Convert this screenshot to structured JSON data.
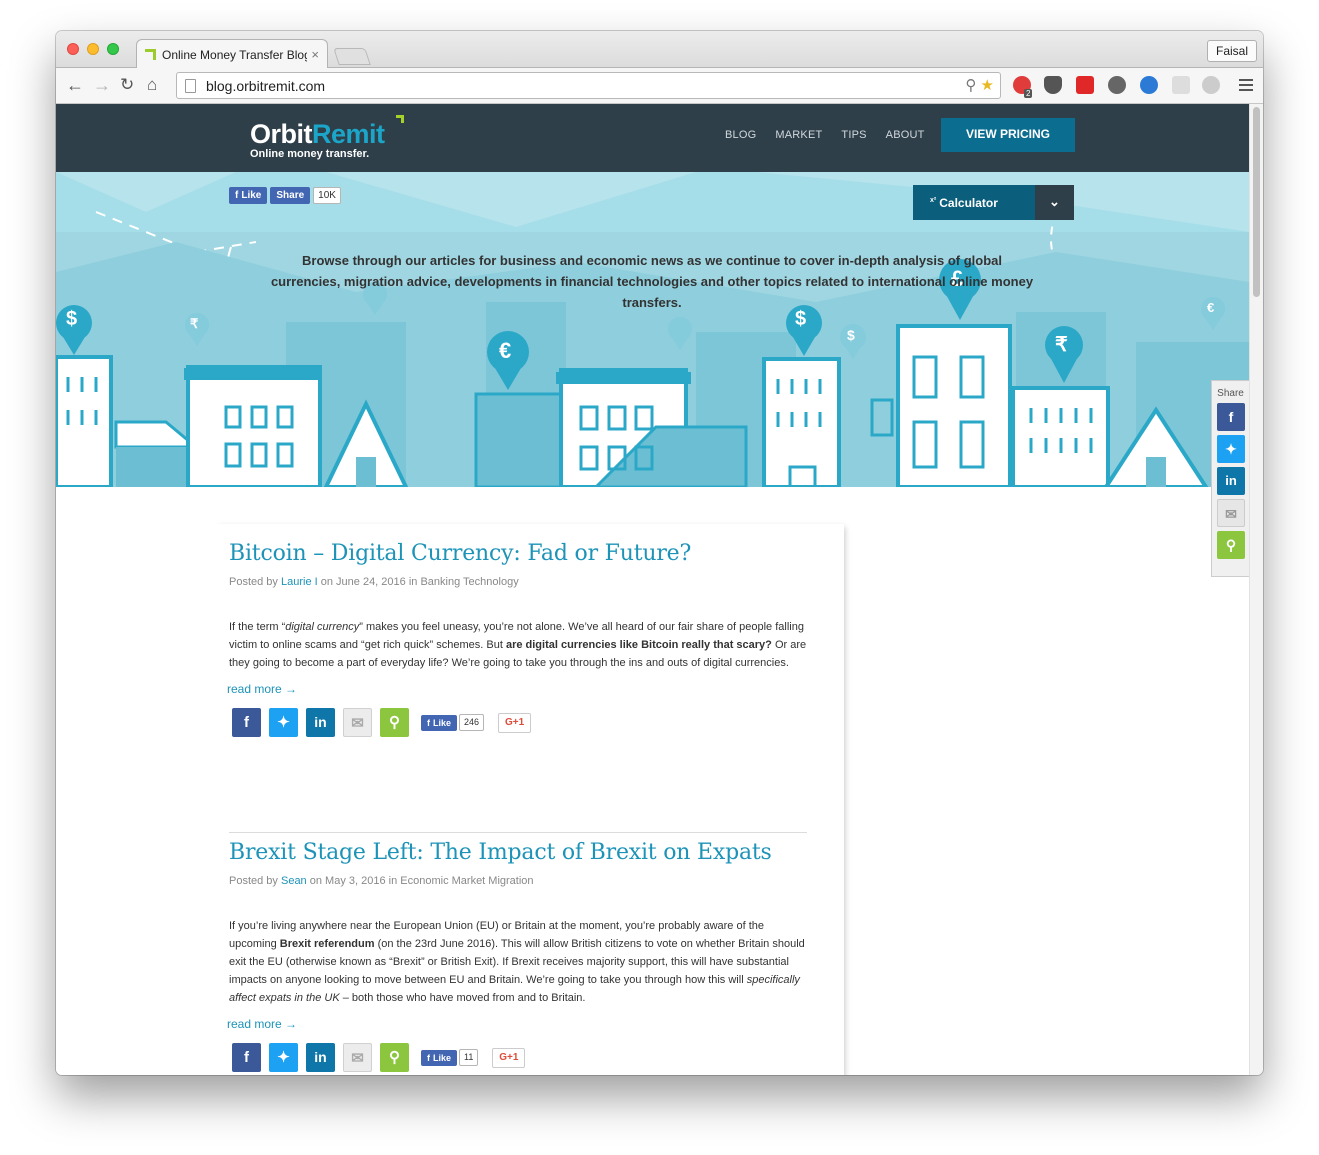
{
  "browser": {
    "tab_title": "Online Money Transfer Blog",
    "tab_close": "×",
    "user_button": "Faisal",
    "url": "blog.orbitremit.com",
    "extension_badge": "2"
  },
  "header": {
    "logo_orbit": "Orbit",
    "logo_remit": "Remit",
    "tagline": "Online money transfer.",
    "nav": [
      "BLOG",
      "MARKET",
      "TIPS",
      "ABOUT"
    ],
    "cta": "VIEW PRICING"
  },
  "hero": {
    "fb_like": "Like",
    "fb_share": "Share",
    "fb_count": "10K",
    "calculator_sup": "x²",
    "calculator_label": "Calculator",
    "intro": "Browse through our articles for business and economic news as we continue to cover in-depth analysis of global currencies, migration advice, developments in financial technologies and other topics related to international online money transfers.",
    "currency_symbols": [
      "$",
      "₹",
      "€",
      "$",
      "$",
      "£",
      "₹",
      "€"
    ]
  },
  "share_sidebar": {
    "label": "Share"
  },
  "posts": [
    {
      "title": "Bitcoin – Digital Currency: Fad or Future?",
      "posted_by": "Posted by",
      "author": "Laurie I",
      "on_date": "on June 24, 2016 in",
      "category": "Banking Technology",
      "body_p1": "If the term “",
      "body_em1": "digital currency",
      "body_p2": "” makes you feel uneasy, you’re not alone. We’ve all heard of our fair share of people falling victim to online scams and “get rich quick” schemes. But ",
      "body_b1": "are digital currencies like Bitcoin really that scary?",
      "body_p3": " Or are they going to become a part of everyday life? We’re going to take you through the ins and outs of digital currencies.",
      "read_more": "read more →",
      "like_label": "Like",
      "like_count": "246",
      "gplus": "G+1"
    },
    {
      "title": "Brexit Stage Left: The Impact of Brexit on Expats",
      "posted_by": "Posted by",
      "author": "Sean",
      "on_date": "on May 3, 2016 in",
      "category": "Economic Market Migration",
      "body_p1": "If you’re living anywhere near the European Union (EU) or Britain at the moment, you’re probably aware of the upcoming ",
      "body_b1": "Brexit referendum",
      "body_p2": " (on the 23rd June 2016). This will allow British citizens to vote on whether Britain should exit the EU (otherwise known as “Brexit” or British Exit). If Brexit receives majority support, this will have substantial impacts on anyone looking to move between EU and Britain. We’re going to take you through how this will ",
      "body_em1": "specifically affect expats in the UK",
      "body_p3": " – both those who have moved from and to Britain.",
      "read_more": "read more →",
      "like_label": "Like",
      "like_count": "11",
      "gplus": "G+1"
    }
  ],
  "colors": {
    "header_bg": "#2f3f4a",
    "accent_blue": "#1d93b8",
    "hero_bg": "#a5dde8",
    "lime": "#a4d22a",
    "facebook": "#3b5998",
    "twitter": "#1da1f2",
    "linkedin": "#0e76a8",
    "email": "#dadada",
    "share": "#8cc63f"
  }
}
